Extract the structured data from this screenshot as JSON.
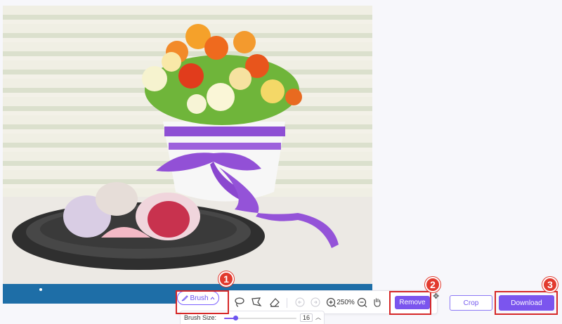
{
  "editor": {
    "photo_alt": "Flower pot and mochi on plate",
    "toolbar": {
      "brush_label": "Brush",
      "zoom_level": "250%",
      "remove_label": "Remove"
    },
    "brush_size": {
      "label": "Brush Size:",
      "value": "16",
      "slider_fraction": 0.16
    },
    "crop_label": "Crop",
    "download_label": "Download"
  },
  "callouts": [
    "1",
    "2",
    "3"
  ],
  "colors": {
    "accent": "#7b55ee",
    "callout_red": "#d62828",
    "photo_bottom_bar": "#1e6ea7"
  }
}
